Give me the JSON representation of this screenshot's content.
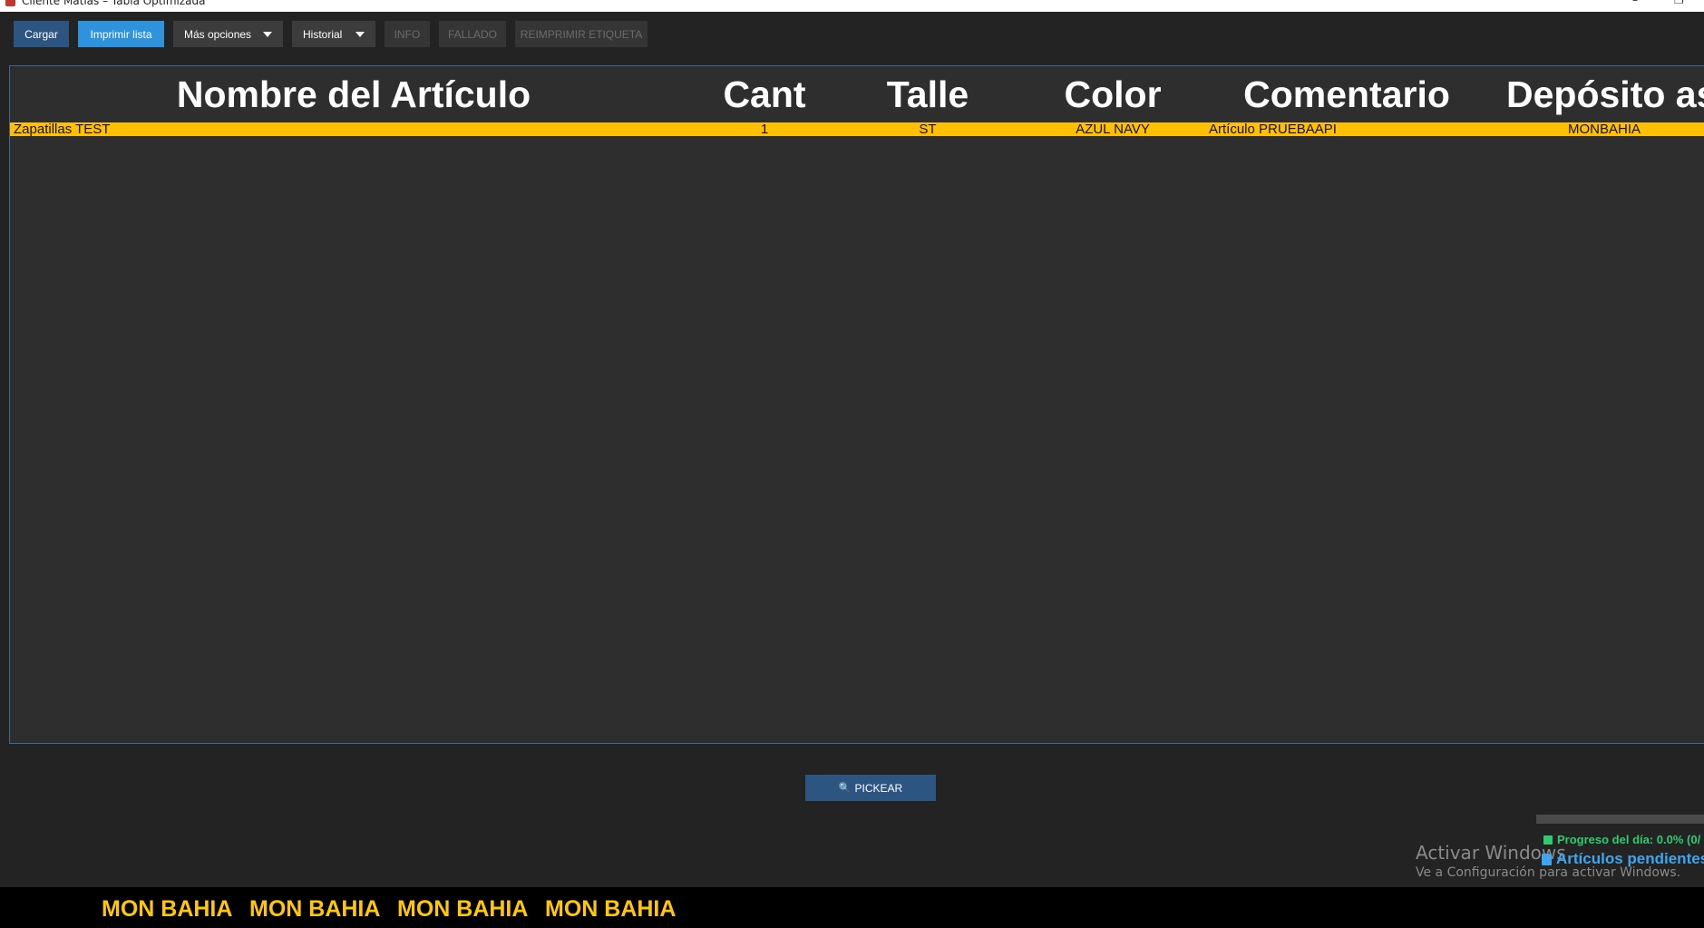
{
  "window": {
    "title": "Cliente Matías – Tabla Optimizada",
    "controls": {
      "minimize": "–",
      "restore": "❐"
    }
  },
  "toolbar": {
    "cargar": "Cargar",
    "imprimir_lista": "Imprimir lista",
    "mas_opciones": "Más opciones",
    "historial": "Historial",
    "info": "INFO",
    "fallado": "FALLADO",
    "reimprimir_etiqueta": "REIMPRIMIR ETIQUETA"
  },
  "table": {
    "headers": {
      "nombre": "Nombre del Artículo",
      "cant": "Cant",
      "talle": "Talle",
      "color": "Color",
      "comentario": "Comentario",
      "deposito": "Depósito asi"
    },
    "rows": [
      {
        "nombre": "Zapatillas TEST",
        "cant": "1",
        "talle": "ST",
        "color": "AZUL NAVY",
        "comentario": "Artículo PRUEBAAPI",
        "deposito": "MONBAHIA"
      }
    ],
    "highlight_color": "#ffc000"
  },
  "pickear": {
    "icon": "🔍",
    "label": "PICKEAR"
  },
  "progress": {
    "text": "Progreso del día: 0.0% (0/",
    "value_percent": 0.0,
    "pending_label": "Artículos pendientes:"
  },
  "watermark": {
    "title": "Activar Windows",
    "subtitle": "Ve a Configuración para activar Windows."
  },
  "marquee": {
    "items": [
      "MON BAHIA",
      "MON BAHIA",
      "MON BAHIA",
      "MON BAHIA"
    ],
    "color": "#ffc800"
  }
}
